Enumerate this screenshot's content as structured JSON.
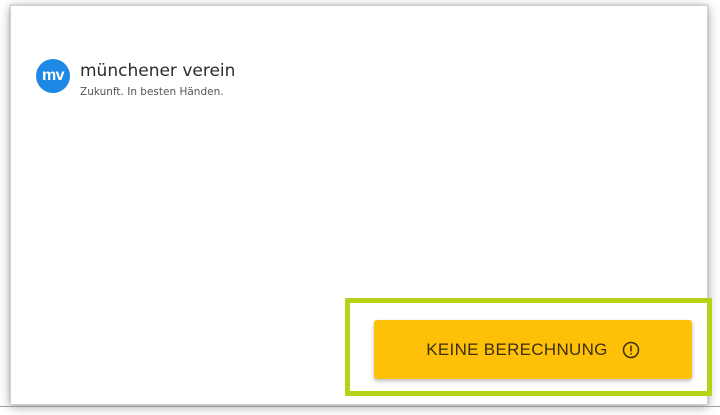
{
  "brand": {
    "logo_mark": "mv",
    "name": "münchener verein",
    "tagline": "Zukunft. In besten Händen.",
    "color": "#1e88e5"
  },
  "action": {
    "label": "KEINE BERECHNUNG",
    "icon": "alert-circle-icon",
    "color": "#ffc107",
    "highlight_color": "#b8d317"
  }
}
